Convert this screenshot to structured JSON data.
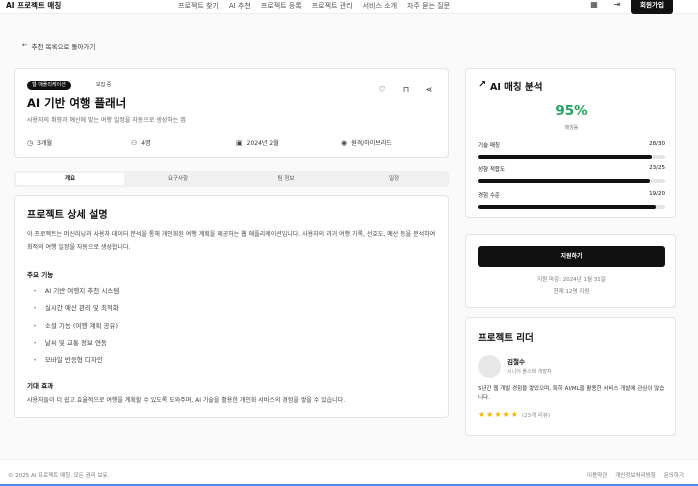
{
  "header": {
    "brand": "AI 프로젝트 매칭",
    "nav": [
      "프로젝트 찾기",
      "AI 추천",
      "프로젝트 등록",
      "프로젝트 관리",
      "서비스 소개",
      "자주 묻는 질문"
    ],
    "signup_label": "회원가입",
    "icons": [
      "grid-icon",
      "login-icon"
    ]
  },
  "back_link": "추천 목록으로 돌아가기",
  "project": {
    "category_badge": "웹 애플리케이션",
    "status_badge": "모집 중",
    "title": "AI 기반 여행 플래너",
    "subtitle": "사용자의 취향과 예산에 맞는 여행 일정을 자동으로 생성하는 앱",
    "meta": {
      "duration": "3개월",
      "team_size": "4명",
      "start_date": "2024년 2월",
      "location": "원격/하이브리드"
    }
  },
  "tabs": [
    "개요",
    "요구사항",
    "팀 정보",
    "일정"
  ],
  "details": {
    "title": "프로젝트 상세 설명",
    "description": "이 프로젝트는 머신러닝과 사용자 데이터 분석을 통해 개인화된 여행 계획을 제공하는 웹 애플리케이션입니다. 사용자의 과거 여행 기록, 선호도, 예산 등을 분석하여 최적의 여행 일정을 자동으로 생성합니다.",
    "features_heading": "주요 기능",
    "features": [
      "AI 기반 여행지 추천 시스템",
      "실시간 예산 관리 및 최적화",
      "소셜 기능 (여행 계획 공유)",
      "날씨 및 교통 정보 연동",
      "모바일 반응형 디자인"
    ],
    "effect_heading": "기대 효과",
    "effect_text": "사용자들이 더 쉽고 효율적으로 여행을 계획할 수 있도록 도와주며, AI 기술을 활용한 개인화 서비스의 경험을 쌓을 수 있습니다."
  },
  "analysis": {
    "title": "AI 매칭 분석",
    "percent": "95%",
    "percent_label": "매칭률",
    "metrics": [
      {
        "label": "기술 매칭",
        "value": "28/30",
        "fraction": 0.933
      },
      {
        "label": "성향 적합도",
        "value": "23/25",
        "fraction": 0.92
      },
      {
        "label": "경험 수준",
        "value": "19/20",
        "fraction": 0.95
      }
    ]
  },
  "apply": {
    "button": "지원하기",
    "deadline": "지원 마감: 2024년 1월 31일",
    "applicants": "현재 12명 지원"
  },
  "leader": {
    "title": "프로젝트 리더",
    "name": "김철수",
    "role": "시니어 풀스택 개발자",
    "bio": "5년간 웹 개발 경험을 쌓았으며, 특히 AI/ML을 활용한 서비스 개발에 관심이 많습니다.",
    "rating": 5,
    "reviews": "(23개 리뷰)"
  },
  "footer": {
    "copyright": "© 2025 AI 프로젝트 매칭. 모든 권리 보유.",
    "links": [
      "이용약관",
      "개인정보처리방침",
      "문의하기"
    ]
  }
}
